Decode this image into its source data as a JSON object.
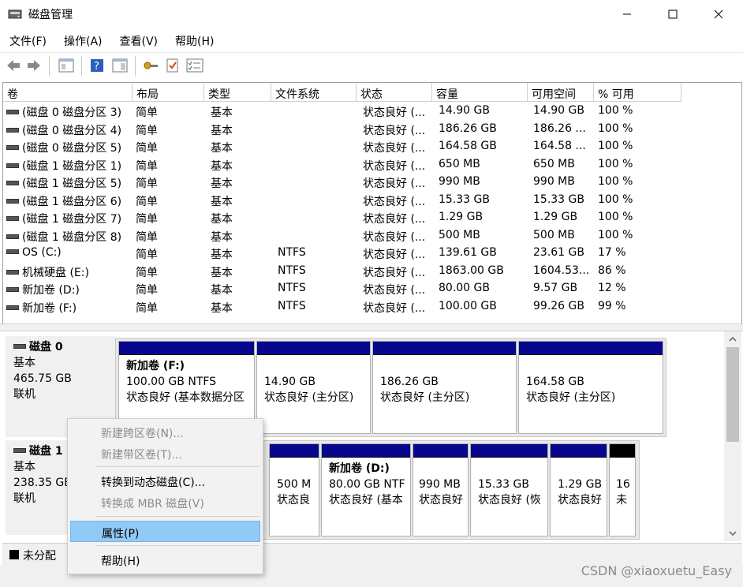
{
  "window": {
    "title": "磁盘管理"
  },
  "menu": [
    "文件(F)",
    "操作(A)",
    "查看(V)",
    "帮助(H)"
  ],
  "columns": [
    "卷",
    "布局",
    "类型",
    "文件系统",
    "状态",
    "容量",
    "可用空间",
    "% 可用"
  ],
  "volumes": [
    {
      "vol": "(磁盘 0 磁盘分区 3)",
      "layout": "简单",
      "type": "基本",
      "fs": "",
      "status": "状态良好 (...",
      "cap": "14.90 GB",
      "free": "14.90 GB",
      "pct": "100 %"
    },
    {
      "vol": "(磁盘 0 磁盘分区 4)",
      "layout": "简单",
      "type": "基本",
      "fs": "",
      "status": "状态良好 (...",
      "cap": "186.26 GB",
      "free": "186.26 ...",
      "pct": "100 %"
    },
    {
      "vol": "(磁盘 0 磁盘分区 5)",
      "layout": "简单",
      "type": "基本",
      "fs": "",
      "status": "状态良好 (...",
      "cap": "164.58 GB",
      "free": "164.58 ...",
      "pct": "100 %"
    },
    {
      "vol": "(磁盘 1 磁盘分区 1)",
      "layout": "简单",
      "type": "基本",
      "fs": "",
      "status": "状态良好 (...",
      "cap": "650 MB",
      "free": "650 MB",
      "pct": "100 %"
    },
    {
      "vol": "(磁盘 1 磁盘分区 5)",
      "layout": "简单",
      "type": "基本",
      "fs": "",
      "status": "状态良好 (...",
      "cap": "990 MB",
      "free": "990 MB",
      "pct": "100 %"
    },
    {
      "vol": "(磁盘 1 磁盘分区 6)",
      "layout": "简单",
      "type": "基本",
      "fs": "",
      "status": "状态良好 (...",
      "cap": "15.33 GB",
      "free": "15.33 GB",
      "pct": "100 %"
    },
    {
      "vol": "(磁盘 1 磁盘分区 7)",
      "layout": "简单",
      "type": "基本",
      "fs": "",
      "status": "状态良好 (...",
      "cap": "1.29 GB",
      "free": "1.29 GB",
      "pct": "100 %"
    },
    {
      "vol": "(磁盘 1 磁盘分区 8)",
      "layout": "简单",
      "type": "基本",
      "fs": "",
      "status": "状态良好 (...",
      "cap": "500 MB",
      "free": "500 MB",
      "pct": "100 %"
    },
    {
      "vol": "OS (C:)",
      "layout": "简单",
      "type": "基本",
      "fs": "NTFS",
      "status": "状态良好 (...",
      "cap": "139.61 GB",
      "free": "23.61 GB",
      "pct": "17 %"
    },
    {
      "vol": "机械硬盘 (E:)",
      "layout": "简单",
      "type": "基本",
      "fs": "NTFS",
      "status": "状态良好 (...",
      "cap": "1863.00 GB",
      "free": "1604.53...",
      "pct": "86 %"
    },
    {
      "vol": "新加卷 (D:)",
      "layout": "简单",
      "type": "基本",
      "fs": "NTFS",
      "status": "状态良好 (...",
      "cap": "80.00 GB",
      "free": "9.57 GB",
      "pct": "12 %"
    },
    {
      "vol": "新加卷 (F:)",
      "layout": "简单",
      "type": "基本",
      "fs": "NTFS",
      "status": "状态良好 (...",
      "cap": "100.00 GB",
      "free": "99.26 GB",
      "pct": "99 %"
    }
  ],
  "disk0": {
    "name": "磁盘 0",
    "kind": "基本",
    "size": "465.75 GB",
    "state": "联机",
    "parts": [
      {
        "name": "新加卷 (F:)",
        "line1": "100.00 GB NTFS",
        "line2": "状态良好 (基本数据分区"
      },
      {
        "name": "",
        "line1": "14.90 GB",
        "line2": "状态良好 (主分区)"
      },
      {
        "name": "",
        "line1": "186.26 GB",
        "line2": "状态良好 (主分区)"
      },
      {
        "name": "",
        "line1": "164.58 GB",
        "line2": "状态良好 (主分区)"
      }
    ]
  },
  "disk1": {
    "name": "磁盘 1",
    "kind": "基本",
    "size": "238.35 GB",
    "state": "联机",
    "parts": [
      {
        "name": "",
        "line1": "500 M",
        "line2": "状态良"
      },
      {
        "name": "新加卷 (D:)",
        "line1": "80.00 GB NTF",
        "line2": "状态良好 (基本"
      },
      {
        "name": "",
        "line1": "990 MB",
        "line2": "状态良好"
      },
      {
        "name": "",
        "line1": "15.33 GB",
        "line2": "状态良好 (恢"
      },
      {
        "name": "",
        "line1": "1.29 GB",
        "line2": "状态良好"
      },
      {
        "name": "",
        "line1": "16",
        "line2": "未"
      }
    ]
  },
  "legend": {
    "unallocated": "未分配"
  },
  "context_menu": [
    {
      "label": "新建跨区卷(N)...",
      "enabled": false
    },
    {
      "label": "新建带区卷(T)...",
      "enabled": false
    },
    {
      "label": "转换到动态磁盘(C)...",
      "enabled": true
    },
    {
      "label": "转换成 MBR 磁盘(V)",
      "enabled": false
    },
    {
      "label": "属性(P)",
      "enabled": true,
      "highlighted": true
    },
    {
      "label": "帮助(H)",
      "enabled": true
    }
  ],
  "watermark": "CSDN @xiaoxuetu_Easy",
  "colors": {
    "partition_bar": "#07078e",
    "unallocated": "#000000",
    "menu_highlight": "#91c9f7"
  }
}
